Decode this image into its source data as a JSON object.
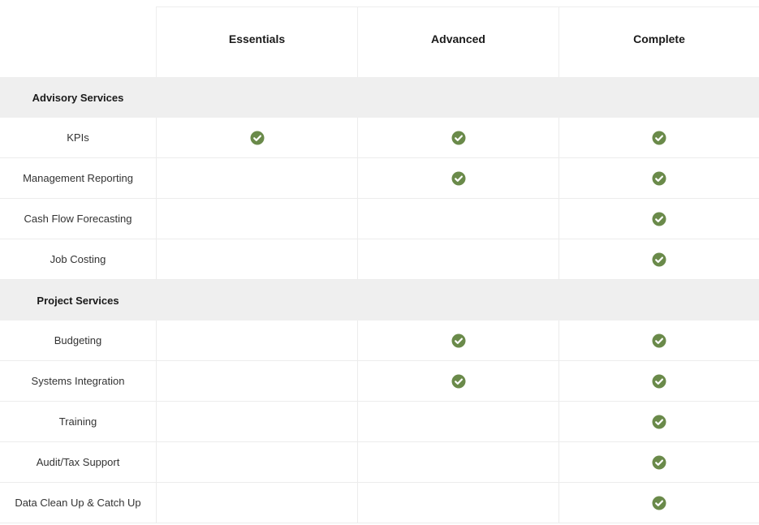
{
  "colors": {
    "check": "#6a8a4a",
    "section_bg": "#efefef",
    "border": "#ececec"
  },
  "header": {
    "columns": [
      "Essentials",
      "Advanced",
      "Complete"
    ]
  },
  "sections": [
    {
      "title": "Advisory Services",
      "rows": [
        {
          "label": "KPIs",
          "checks": [
            true,
            true,
            true
          ]
        },
        {
          "label": "Management Reporting",
          "checks": [
            false,
            true,
            true
          ]
        },
        {
          "label": "Cash Flow Forecasting",
          "checks": [
            false,
            false,
            true
          ]
        },
        {
          "label": "Job Costing",
          "checks": [
            false,
            false,
            true
          ]
        }
      ]
    },
    {
      "title": "Project Services",
      "rows": [
        {
          "label": "Budgeting",
          "checks": [
            false,
            true,
            true
          ]
        },
        {
          "label": "Systems Integration",
          "checks": [
            false,
            true,
            true
          ]
        },
        {
          "label": "Training",
          "checks": [
            false,
            false,
            true
          ]
        },
        {
          "label": "Audit/Tax Support",
          "checks": [
            false,
            false,
            true
          ]
        },
        {
          "label": "Data Clean Up & Catch Up",
          "checks": [
            false,
            false,
            true
          ]
        }
      ]
    }
  ]
}
